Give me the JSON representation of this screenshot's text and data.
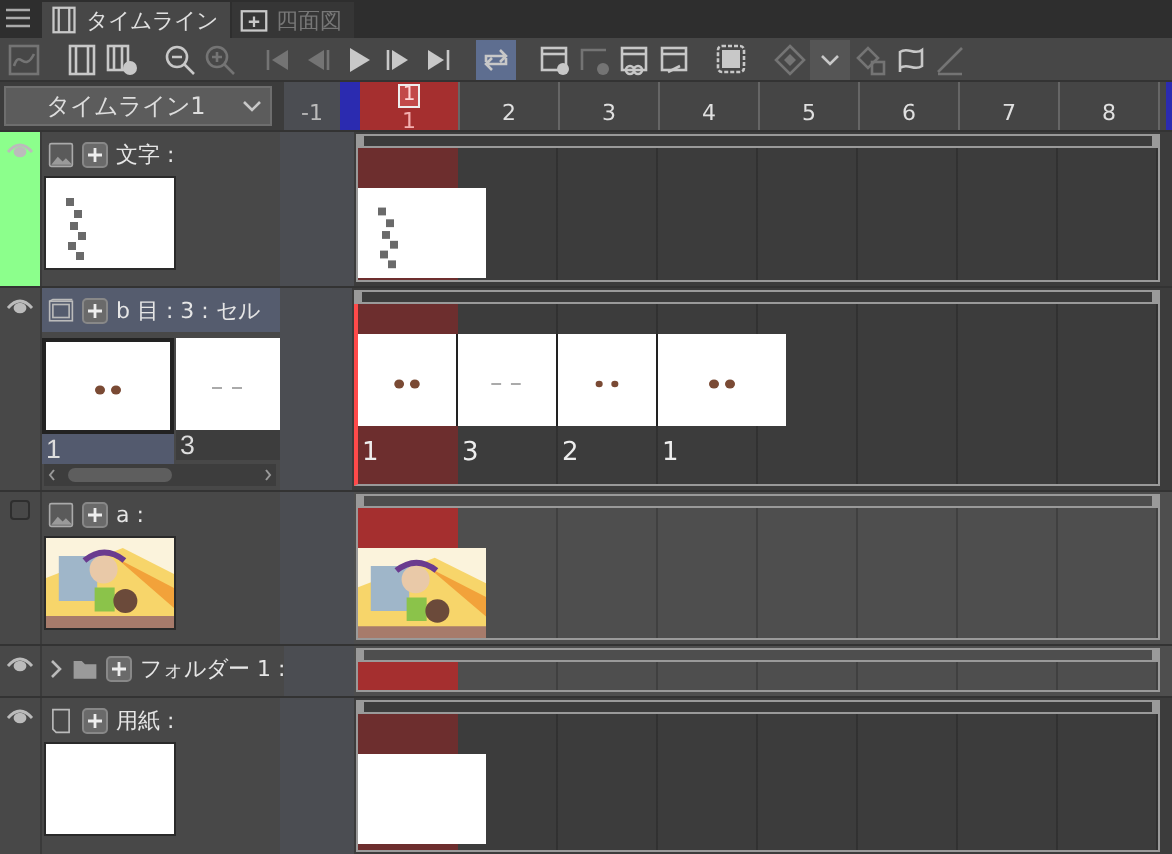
{
  "tabs": [
    {
      "label": "タイムライン",
      "selected": true
    },
    {
      "label": "四面図",
      "selected": false
    }
  ],
  "toolbar": [
    {
      "kind": "graph",
      "disabled": true,
      "on": false
    },
    {
      "kind": "frames",
      "disabled": false,
      "on": false
    },
    {
      "kind": "frames-add",
      "disabled": false,
      "on": false
    },
    {
      "kind": "zoom-out",
      "disabled": false,
      "on": false
    },
    {
      "kind": "zoom-in",
      "disabled": true,
      "on": false
    },
    {
      "kind": "first",
      "disabled": true,
      "on": false
    },
    {
      "kind": "prev",
      "disabled": true,
      "on": false
    },
    {
      "kind": "play",
      "disabled": false,
      "on": false
    },
    {
      "kind": "next",
      "disabled": false,
      "on": false
    },
    {
      "kind": "last",
      "disabled": false,
      "on": false
    },
    {
      "kind": "loop",
      "disabled": false,
      "on": true
    },
    {
      "kind": "new-cel",
      "disabled": false,
      "on": false
    },
    {
      "kind": "new-cel-alt",
      "disabled": true,
      "on": false
    },
    {
      "kind": "link",
      "disabled": false,
      "on": false
    },
    {
      "kind": "link-alt",
      "disabled": false,
      "on": false
    },
    {
      "kind": "onion",
      "disabled": false,
      "on": false
    },
    {
      "kind": "keyframe",
      "disabled": true,
      "on": false
    },
    {
      "kind": "caret",
      "disabled": false,
      "on": true
    },
    {
      "kind": "delete",
      "disabled": true,
      "on": false
    },
    {
      "kind": "flag",
      "disabled": false,
      "on": false
    },
    {
      "kind": "pen",
      "disabled": true,
      "on": false
    }
  ],
  "timeline_select": {
    "value": "タイムライン1"
  },
  "ruler": {
    "pre_label": "-1",
    "playhead": "1",
    "frames": [
      {
        "label": "1",
        "current": true
      },
      {
        "label": "2",
        "current": false
      },
      {
        "label": "3",
        "current": false
      },
      {
        "label": "4",
        "current": false
      },
      {
        "label": "5",
        "current": false
      },
      {
        "label": "6",
        "current": false
      },
      {
        "label": "7",
        "current": false
      },
      {
        "label": "8",
        "current": false
      }
    ]
  },
  "layers": [
    {
      "kind": "raster",
      "name": "文字 :",
      "visible": true,
      "selected": false,
      "color": "#8cff8c",
      "track": {
        "dimmed": false
      }
    },
    {
      "kind": "animation",
      "name": "b 目 : 3 : セル",
      "visible": true,
      "selected": true,
      "cel_strip": [
        {
          "label": "1",
          "selected": true
        },
        {
          "label": "3",
          "selected": false
        }
      ],
      "track": {
        "dimmed": false,
        "cells": [
          {
            "kind": "picture",
            "label": "1"
          },
          {
            "kind": "picture",
            "label": "3"
          },
          {
            "kind": "picture",
            "label": "2"
          },
          {
            "kind": "picture",
            "label": "1"
          }
        ]
      }
    },
    {
      "kind": "raster",
      "name": "a :",
      "visible": false,
      "selected": false,
      "track": {
        "dimmed": true
      }
    },
    {
      "kind": "folder",
      "name": "フォルダー 1 :",
      "visible": true,
      "selected": false,
      "expanded": false,
      "track": {
        "dimmed": true
      }
    },
    {
      "kind": "paper",
      "name": "用紙 :",
      "visible": true,
      "selected": false,
      "thumbnail": {
        "kind": "blank"
      },
      "track": {
        "dimmed": false,
        "cells": [
          {
            "kind": "blank"
          }
        ]
      }
    }
  ]
}
